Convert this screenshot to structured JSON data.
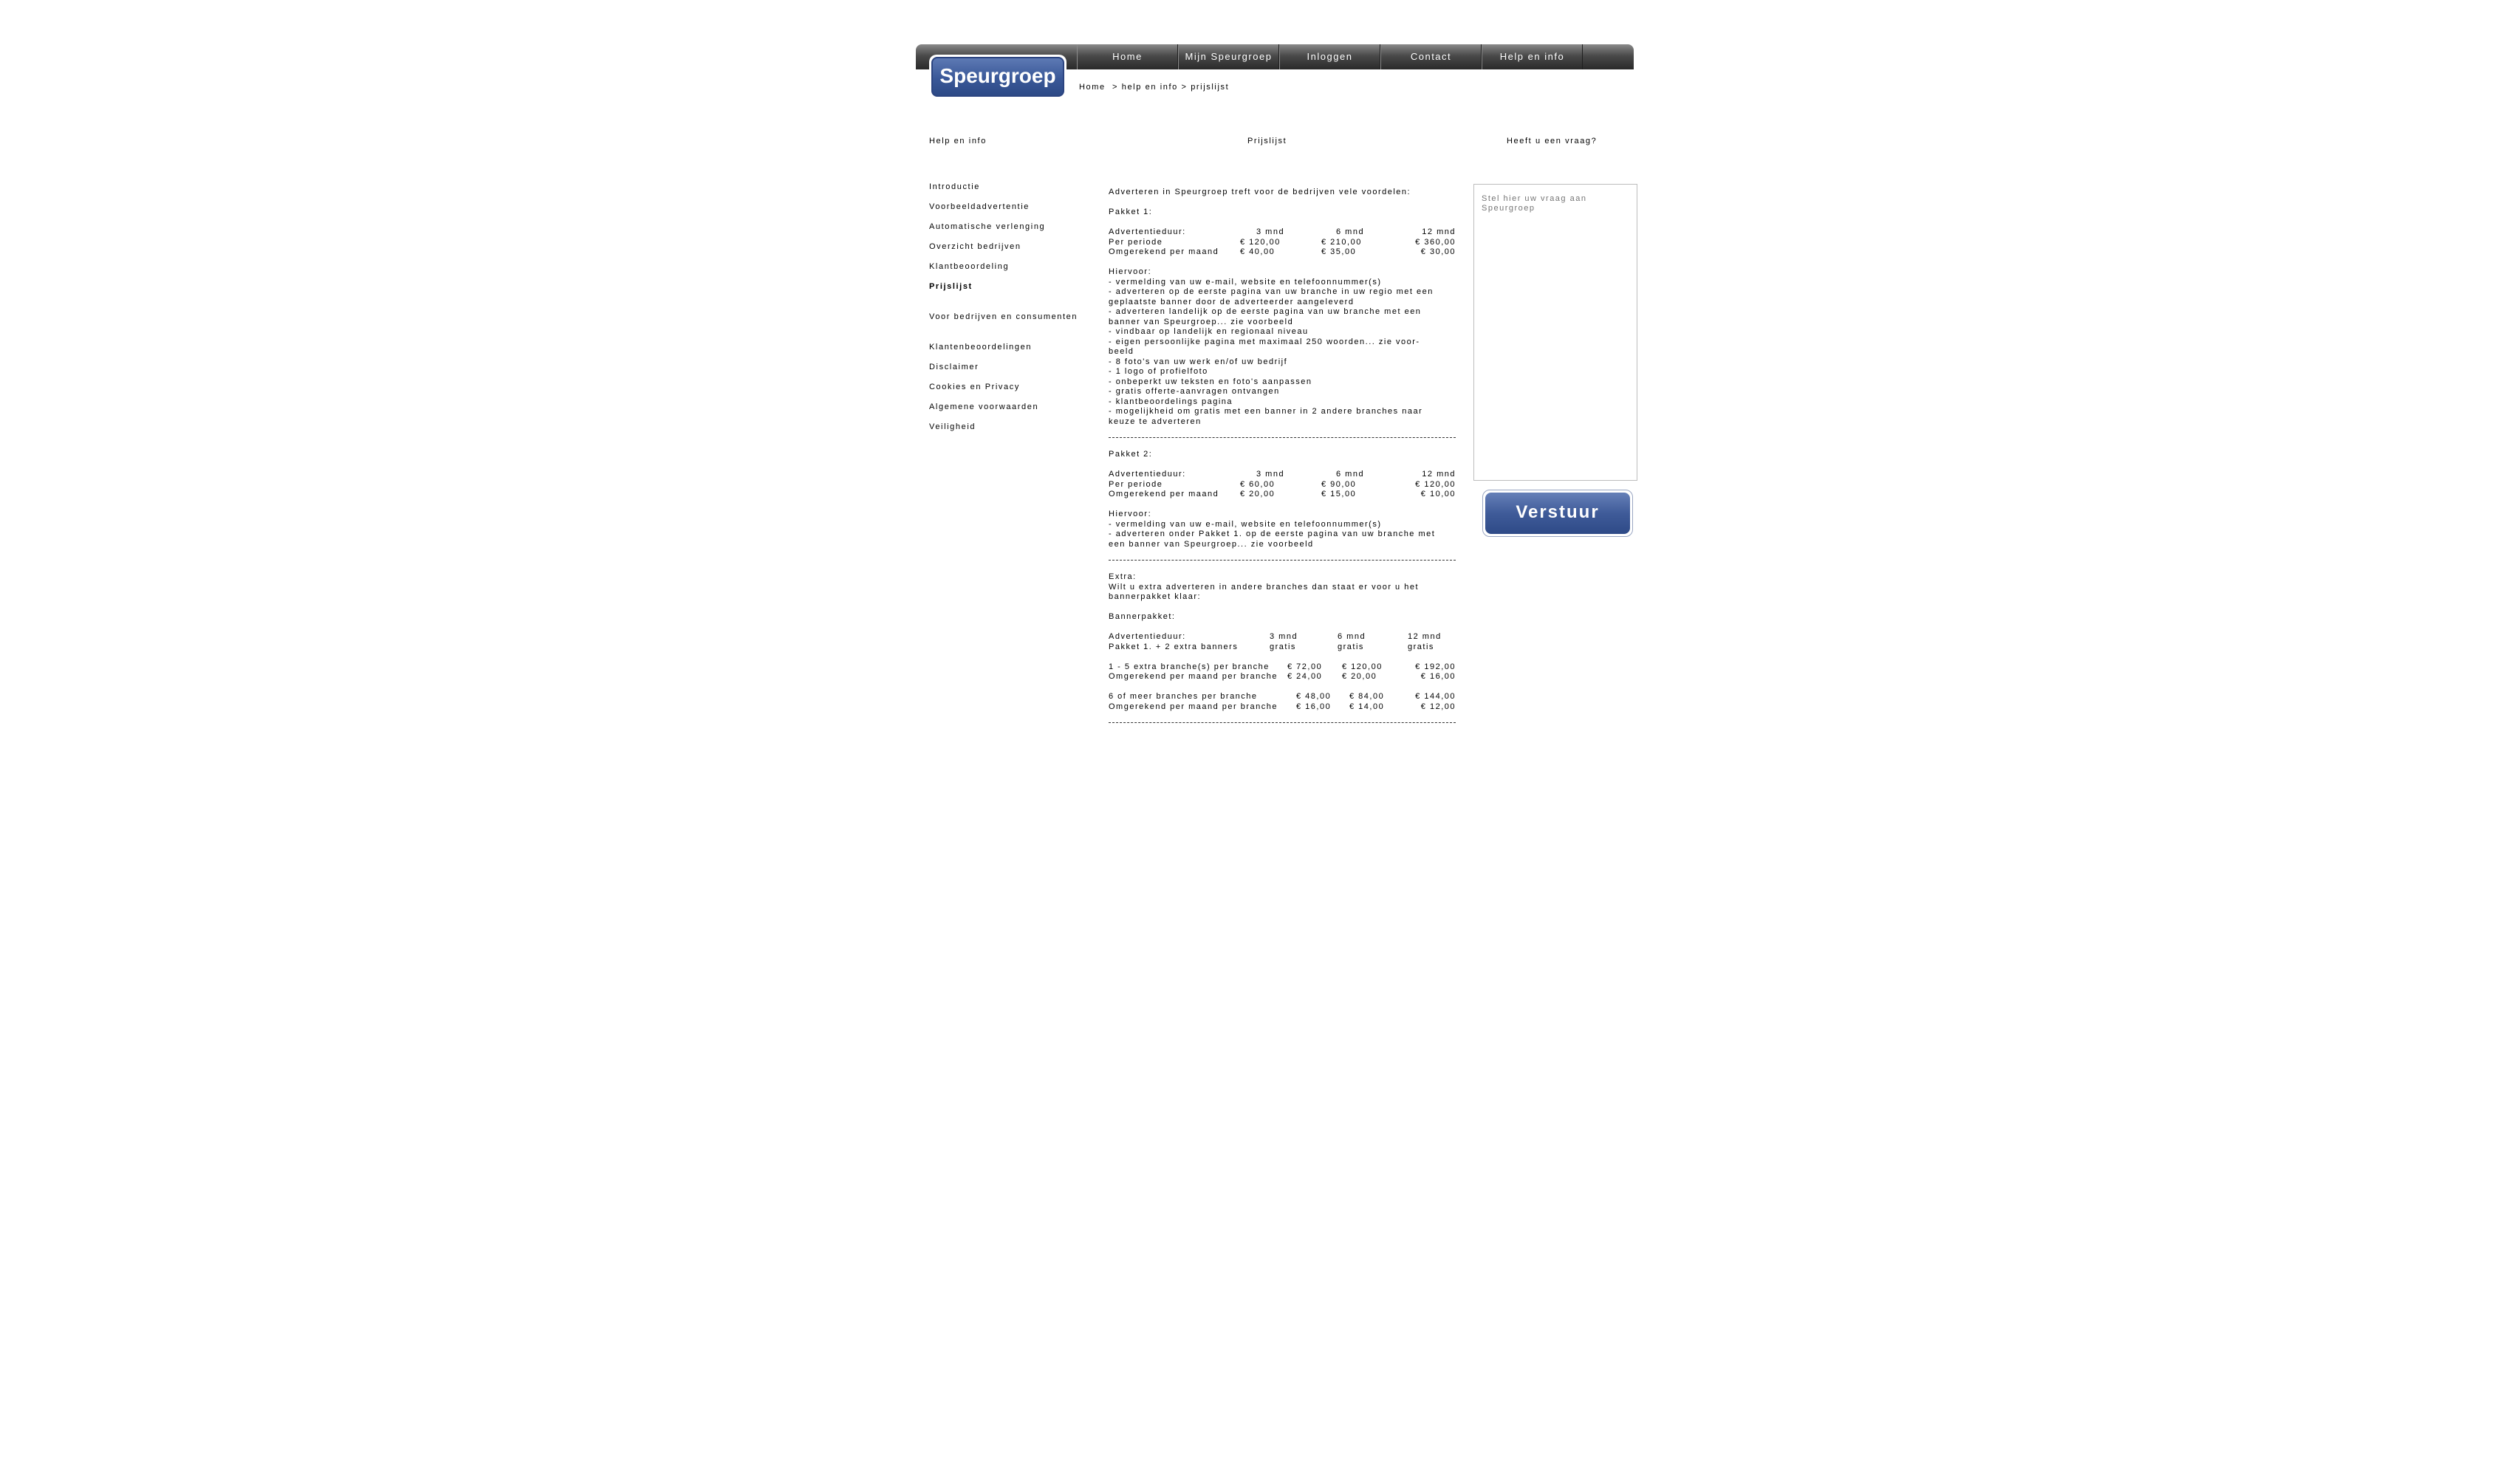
{
  "brand": {
    "logo_text": "Speurgroep"
  },
  "nav": {
    "items": [
      "Home",
      "Mijn Speurgroep",
      "Inloggen",
      "Contact",
      "Help en info"
    ]
  },
  "breadcrumb": {
    "home": "Home",
    "sep1": "  > ",
    "help": "help en info",
    "sep2": " > ",
    "current": "prijslijst"
  },
  "headings": {
    "left": "Help en info",
    "main": "Prijslijst",
    "right": "Heeft u een vraag?"
  },
  "leftmenu": {
    "items": [
      "Introductie",
      "Voorbeeldadvertentie",
      "Automatische verlenging",
      "Overzicht bedrijven",
      "Klantbeoordeling",
      "Prijslijst",
      "Voor bedrijven en consumenten",
      "Klantenbeoordelingen",
      "Disclaimer",
      "Cookies en Privacy",
      "Algemene voorwaarden",
      "Veiligheid"
    ],
    "active": "Prijslijst"
  },
  "main": {
    "intro": "Adverteren in Speurgroep treft voor de bedrijven vele voordelen:",
    "pakket1": {
      "title": "Pakket 1:",
      "header": [
        "Advertentieduur:",
        "3 mnd",
        "6 mnd",
        "12 mnd"
      ],
      "rows": [
        [
          "Per periode",
          "€ 120,00",
          "€ 210,00",
          "€ 360,00"
        ],
        [
          "Omgerekend per maand",
          "€   40,00",
          "€   35,00",
          "€   30,00"
        ]
      ],
      "features_title": "Hiervoor:",
      "features": [
        "- vermelding van uw e-mail, website en telefoonnummer(s)",
        "- adverteren op de eerste pagina van uw branche in uw regio met een",
        "geplaatste banner door de adverteerder aangeleverd",
        "- adverteren landelijk op de eerste pagina van uw branche met een",
        "banner van Speurgroep... zie voorbeeld",
        "- vindbaar op landelijk en regionaal niveau",
        "- eigen persoonlijke pagina met maximaal 250 woorden... zie voor-",
        "beeld",
        "- 8 foto's van uw werk en/of uw bedrijf",
        "- 1 logo of profielfoto",
        "- onbeperkt uw teksten en foto's aanpassen",
        "- gratis offerte-aanvragen ontvangen",
        "- klantbeoordelings pagina",
        "- mogelijkheid om gratis met een banner in 2 andere branches naar",
        "keuze te adverteren"
      ]
    },
    "pakket2": {
      "title": "Pakket 2:",
      "header": [
        "Advertentieduur:",
        "3 mnd",
        "6 mnd",
        "12 mnd"
      ],
      "rows": [
        [
          "Per periode",
          "€   60,00",
          "€   90,00",
          "€ 120,00"
        ],
        [
          "Omgerekend per maand",
          "€   20,00",
          "€   15,00",
          "€   10,00"
        ]
      ],
      "features_title": "Hiervoor:",
      "features": [
        "- vermelding van uw e-mail, website en telefoonnummer(s)",
        "- adverteren onder Pakket 1. op de eerste pagina van uw branche met",
        "een banner van Speurgroep... zie voorbeeld"
      ]
    },
    "extra": {
      "title": "Extra:",
      "text1": "Wilt u extra adverteren in andere branches dan staat er voor u het",
      "text2": "bannerpakket klaar:",
      "banner_title": "Bannerpakket:",
      "header": [
        "Advertentieduur:",
        "3 mnd",
        "6 mnd",
        "12 mnd"
      ],
      "row_pakket": [
        "Pakket 1. + 2 extra banners",
        "gratis",
        "gratis",
        "gratis"
      ],
      "group1": [
        [
          "1 - 5 extra branche(s) per branche",
          "€ 72,00",
          "€ 120,00",
          "€ 192,00"
        ],
        [
          "Omgerekend per maand per branche",
          "€ 24,00",
          "€   20,00",
          "€   16,00"
        ]
      ],
      "group2": [
        [
          "6 of meer branches per branche",
          "€ 48,00",
          "€   84,00",
          "€ 144,00"
        ],
        [
          "Omgerekend per maand per branche",
          "€ 16,00",
          "€   14,00",
          "€   12,00"
        ]
      ]
    }
  },
  "question": {
    "placeholder": "Stel hier uw vraag aan Speurgroep",
    "send_label": "Verstuur"
  },
  "colors": {
    "brand_blue": "#3a5898",
    "nav_dark": "#2a2a2a"
  }
}
